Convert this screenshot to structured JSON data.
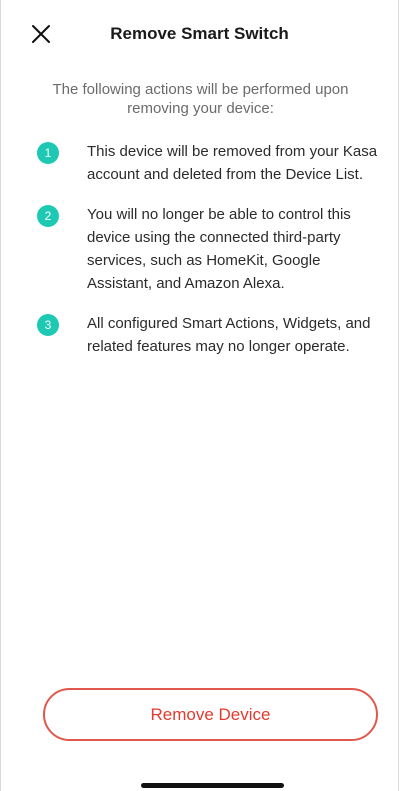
{
  "header": {
    "title": "Remove Smart Switch",
    "close_icon": "close-icon"
  },
  "intro_text": "The following actions will be performed upon removing your device:",
  "steps": [
    {
      "number": "1",
      "text": "This device will be removed from your Kasa account and deleted from the Device List."
    },
    {
      "number": "2",
      "text": "You will no longer be able to control this device using the connected third-party services, such as HomeKit, Google Assistant, and Amazon Alexa."
    },
    {
      "number": "3",
      "text": "All configured Smart Actions, Widgets, and related features may no longer operate."
    }
  ],
  "footer": {
    "remove_label": "Remove Device"
  },
  "colors": {
    "accent_teal": "#1ec9b4",
    "danger_red": "#e23b2f",
    "danger_border": "#e2574c"
  }
}
